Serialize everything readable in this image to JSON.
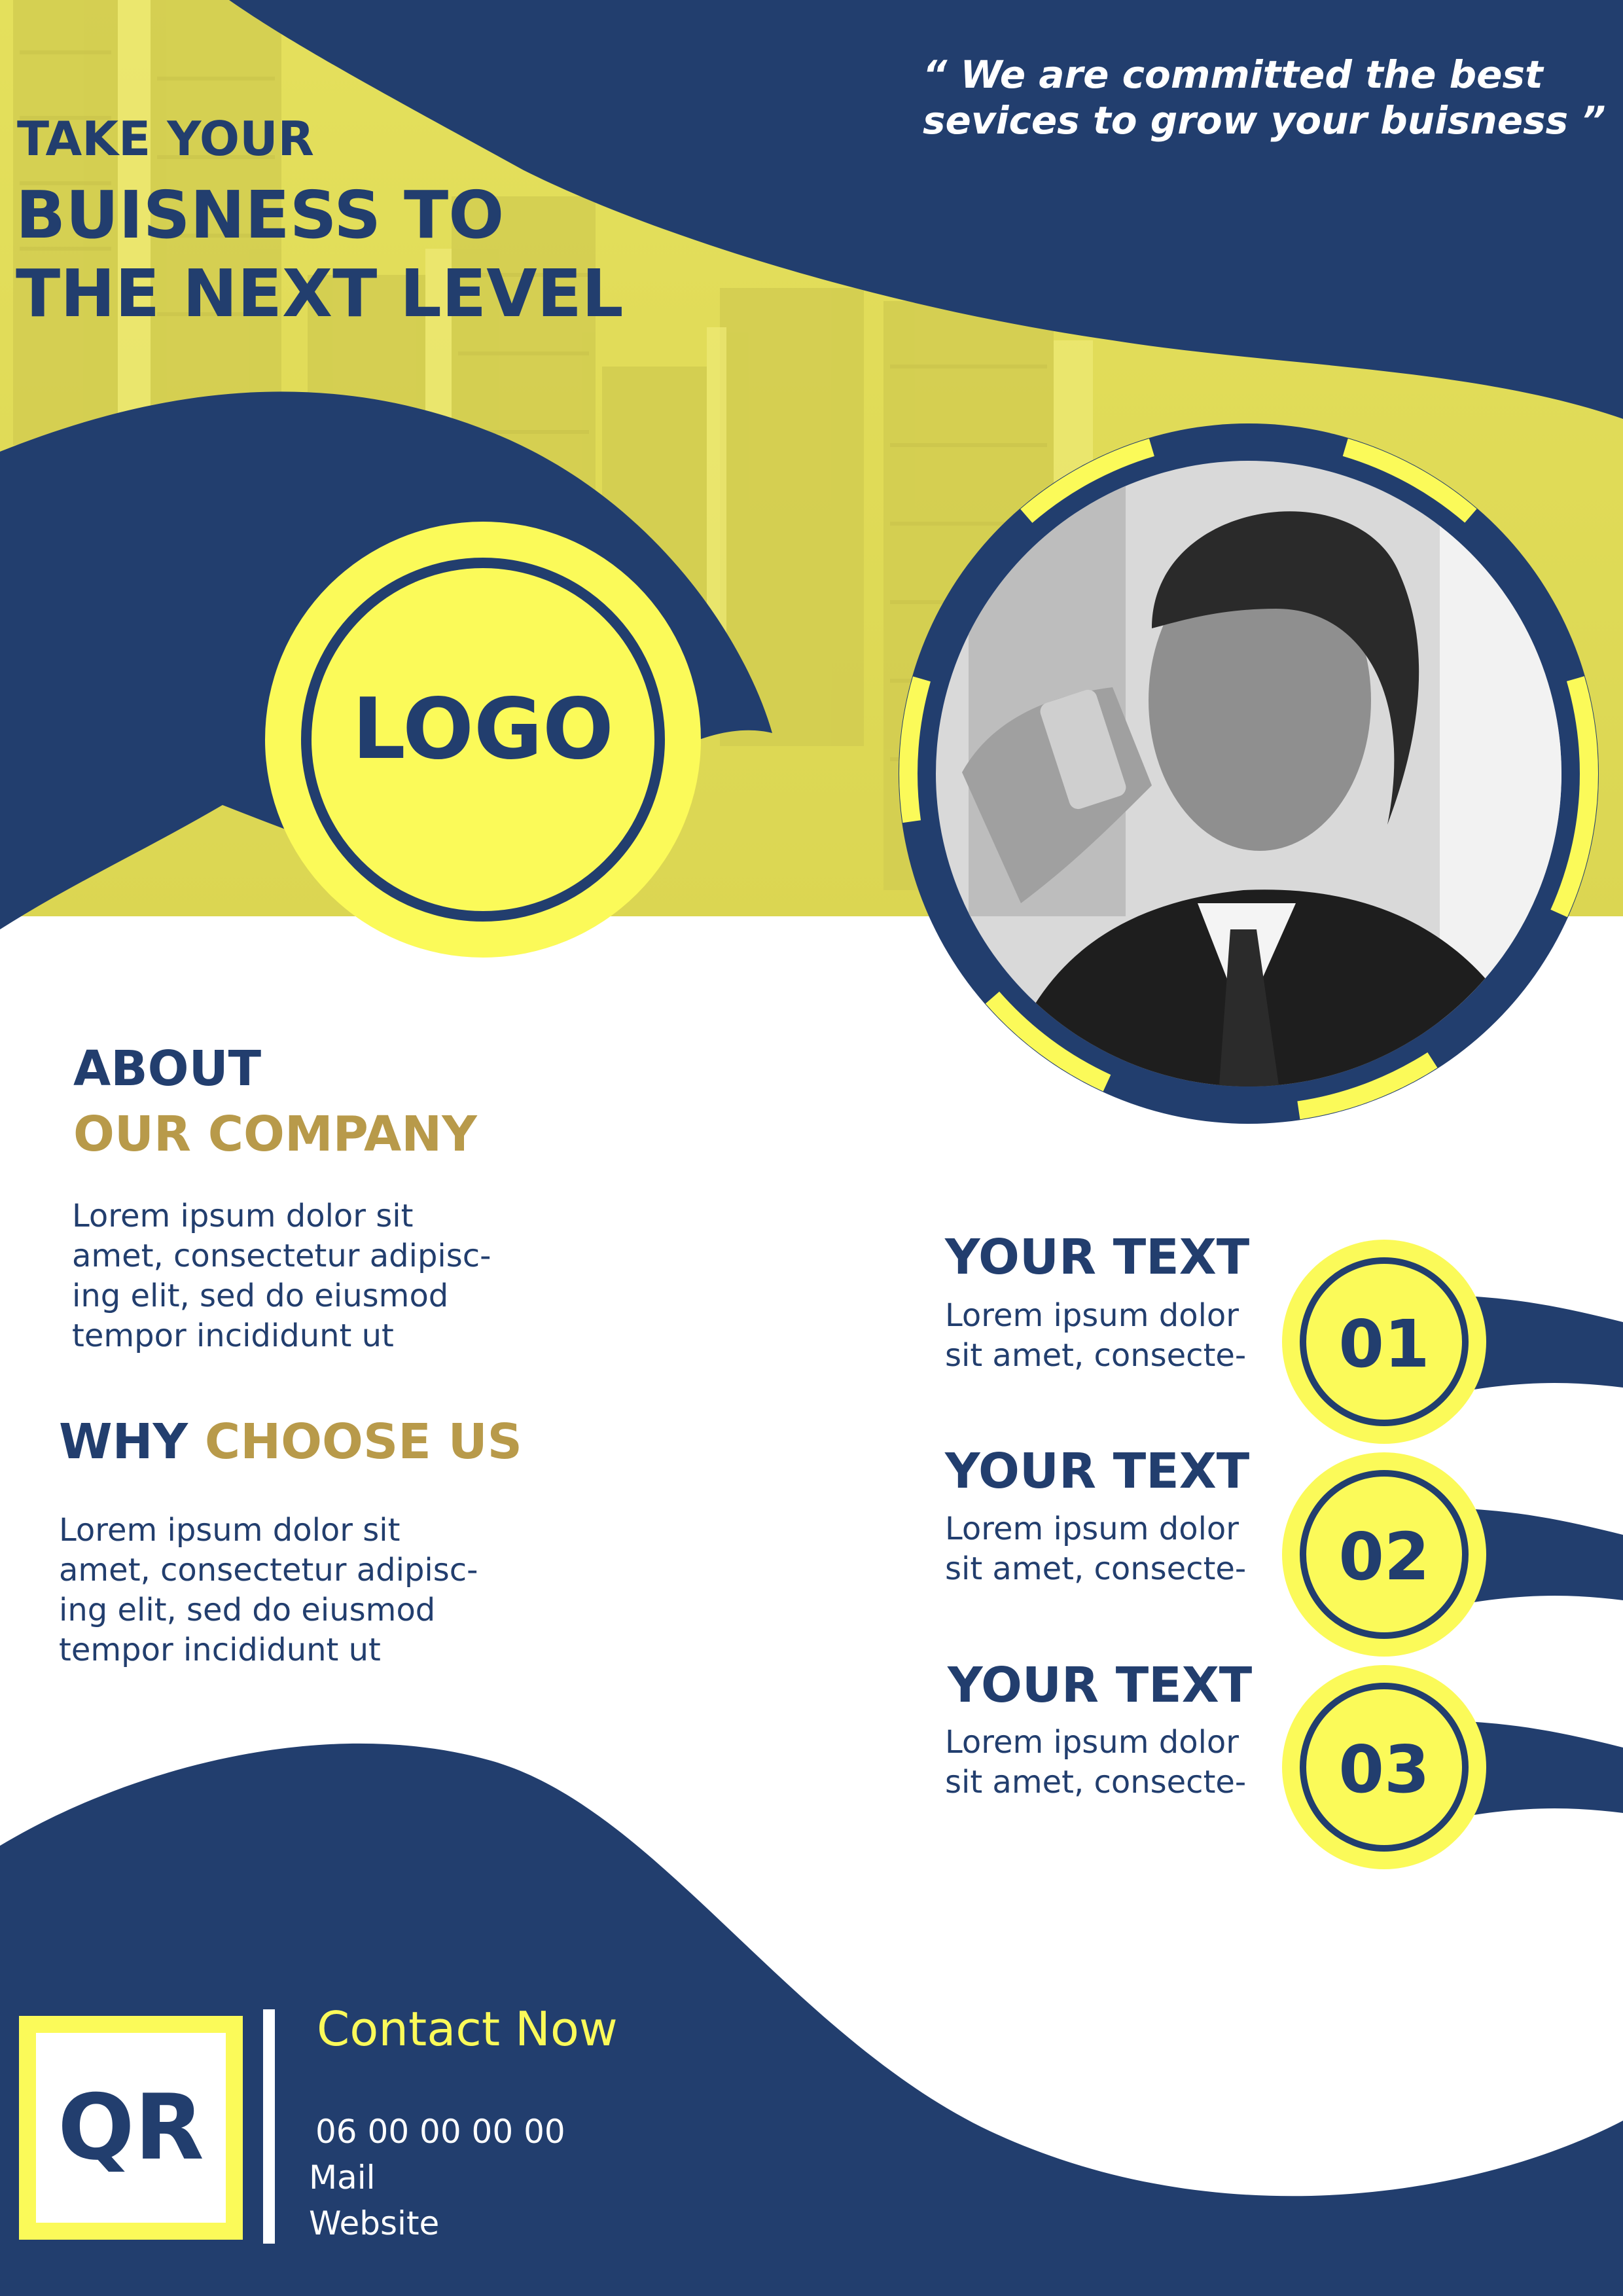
{
  "colors": {
    "navy": "#223e6e",
    "yellow": "#fbfa59",
    "gold": "#b89a4a",
    "photo_tint": "#e8e86c"
  },
  "headline": {
    "line1": "TAKE YOUR",
    "line2": "BUISNESS TO",
    "line3": "THE NEXT LEVEL"
  },
  "quote": {
    "line1": "“ We are committed the best",
    "line2": "sevices to grow your buisness ”"
  },
  "logo": {
    "label": "LOGO"
  },
  "about": {
    "title_part1": "ABOUT",
    "title_part2": "OUR COMPANY",
    "body_lines": [
      "Lorem ipsum dolor sit",
      "amet, consectetur adipisc-",
      "ing elit, sed do eiusmod",
      "tempor incididunt ut"
    ]
  },
  "why": {
    "title_part1": "WHY",
    "title_part2": "CHOOSE US",
    "body_lines": [
      "Lorem ipsum dolor sit",
      "amet, consectetur adipisc-",
      "ing elit, sed do eiusmod",
      "tempor incididunt ut"
    ]
  },
  "features": [
    {
      "title": "YOUR TEXT",
      "body_line1": "Lorem ipsum dolor",
      "body_line2": "sit amet, consecte-",
      "number": "01"
    },
    {
      "title": "YOUR TEXT",
      "body_line1": "Lorem ipsum dolor",
      "body_line2": "sit amet, consecte-",
      "number": "02"
    },
    {
      "title": "YOUR TEXT",
      "body_line1": "Lorem ipsum dolor",
      "body_line2": "sit amet, consecte-",
      "number": "03"
    }
  ],
  "contact": {
    "heading": "Contact Now",
    "phone": "06 00 00 00 00",
    "mail": "Mail",
    "website": "Website",
    "qr_label": "QR"
  },
  "images": {
    "background_photo": "city-skyline-photo",
    "portrait_photo": "businessman-on-phone-photo"
  }
}
